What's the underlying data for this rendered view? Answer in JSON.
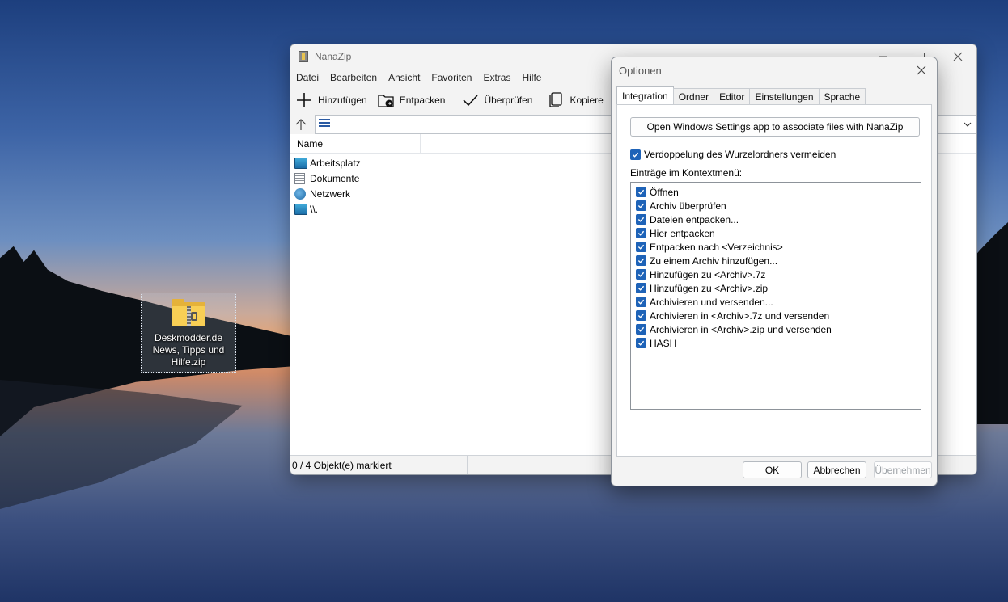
{
  "desktop": {
    "icon_label": "Deskmodder.de News, Tipps und Hilfe.zip"
  },
  "nanazip": {
    "title": "NanaZip",
    "menu": [
      "Datei",
      "Bearbeiten",
      "Ansicht",
      "Favoriten",
      "Extras",
      "Hilfe"
    ],
    "toolbar": {
      "add": "Hinzufügen",
      "extract": "Entpacken",
      "test": "Überprüfen",
      "copy": "Kopiere"
    },
    "list": {
      "header_name": "Name",
      "items": [
        {
          "name": "Arbeitsplatz",
          "icon": "computer-icon"
        },
        {
          "name": "Dokumente",
          "icon": "documents-icon"
        },
        {
          "name": "Netzwerk",
          "icon": "network-icon"
        },
        {
          "name": "\\\\.",
          "icon": "computer-icon"
        }
      ]
    },
    "status": {
      "selected": "0 / 4 Objekt(e) markiert"
    }
  },
  "options": {
    "title": "Optionen",
    "tabs": [
      "Integration",
      "Ordner",
      "Editor",
      "Einstellungen",
      "Sprache"
    ],
    "active_tab": "Integration",
    "assoc_button": "Open Windows Settings app to associate files with NanaZip",
    "root_folder_option": "Verdoppelung des Wurzelordners vermeiden",
    "context_label": "Einträge im Kontextmenü:",
    "context_items": [
      "Öffnen",
      "Archiv überprüfen",
      "Dateien entpacken...",
      "Hier entpacken",
      "Entpacken nach <Verzeichnis>",
      "Zu einem Archiv hinzufügen...",
      "Hinzufügen zu <Archiv>.7z",
      "Hinzufügen zu <Archiv>.zip",
      "Archivieren und versenden...",
      "Archivieren in <Archiv>.7z und versenden",
      "Archivieren in <Archiv>.zip und versenden",
      "HASH"
    ],
    "buttons": {
      "ok": "OK",
      "cancel": "Abbrechen",
      "apply": "Übernehmen"
    },
    "accent_color": "#1e63b8"
  }
}
